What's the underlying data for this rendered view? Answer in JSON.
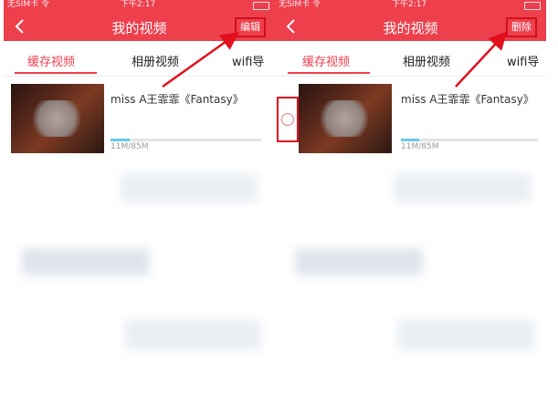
{
  "status_bar": {
    "carrier": "无SIM卡 令",
    "time": "下午2:17"
  },
  "left": {
    "nav_title": "我的视频",
    "action_label": "编辑",
    "tabs": [
      "缓存视频",
      "相册视频",
      "wifi导"
    ],
    "item": {
      "title": "miss A王霏霏《Fantasy》",
      "size": "11M/85M",
      "progress": 0.13
    }
  },
  "right": {
    "nav_title": "我的视频",
    "action_label": "删除",
    "tabs": [
      "缓存视频",
      "相册视频",
      "wifi导"
    ],
    "item": {
      "title": "miss A王霏霏《Fantasy》",
      "size": "11M/85M",
      "progress": 0.13
    }
  },
  "colors": {
    "nav_red": "#ee3f4d",
    "annotation_red": "#e0101c",
    "progress": "#67c7ea"
  },
  "icons": [
    "back-arrow-icon",
    "checkbox-circle-icon",
    "annotation-arrow"
  ]
}
